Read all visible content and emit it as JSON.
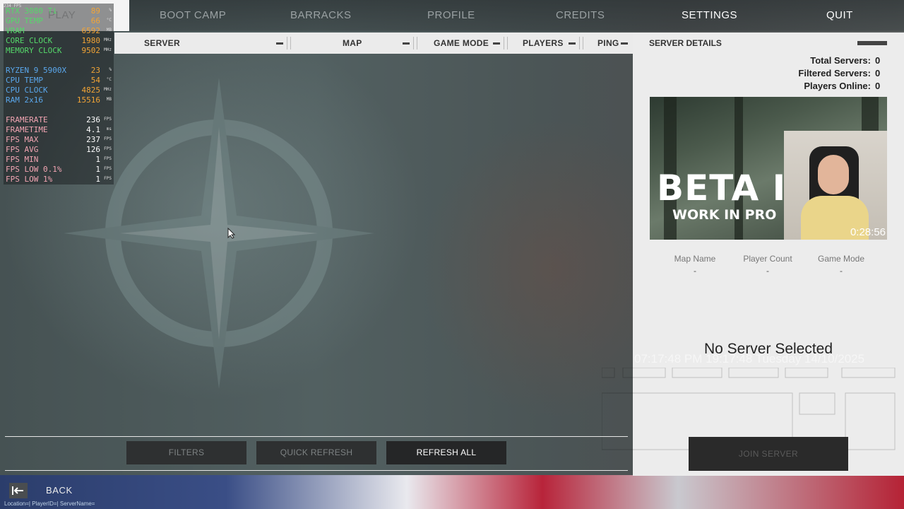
{
  "nav": {
    "play": "PLAY",
    "items": [
      "BOOT CAMP",
      "BARRACKS",
      "PROFILE",
      "CREDITS",
      "SETTINGS",
      "QUIT"
    ],
    "active": "SETTINGS"
  },
  "columns": {
    "server": "SERVER",
    "map": "MAP",
    "game_mode": "GAME MODE",
    "players": "PLAYERS",
    "ping": "PING"
  },
  "details": {
    "title": "SERVER DETAILS",
    "stats": [
      {
        "label": "Total Servers:",
        "value": "0"
      },
      {
        "label": "Filtered Servers:",
        "value": "0"
      },
      {
        "label": "Players Online:",
        "value": "0"
      }
    ],
    "preview": {
      "headline": "BETA I",
      "subtitle": "WORK IN PRO",
      "timer": "0:28:56"
    },
    "fields": [
      {
        "label": "Map Name",
        "value": "-"
      },
      {
        "label": "Player Count",
        "value": "-"
      },
      {
        "label": "Game Mode",
        "value": "-"
      }
    ],
    "no_server": "No Server Selected",
    "watermark": "07:17:48 PM 19:17:48 Tuesday 14/10/2025",
    "join_label": "JOIN SERVER"
  },
  "footer": {
    "filters": "FILTERS",
    "quick_refresh": "QUICK REFRESH",
    "refresh_all": "REFRESH ALL",
    "back": "BACK",
    "status": "Location=| PlayerID=| ServerName="
  },
  "osd": {
    "top_label": "234 FPS",
    "gpu": [
      {
        "k": "RTX 3080 Ti",
        "v": "89",
        "u": "%"
      },
      {
        "k": "GPU TEMP",
        "v": "66",
        "u": "°C"
      },
      {
        "k": "VRAM",
        "v": "6592",
        "u": "MB"
      },
      {
        "k": "CORE CLOCK",
        "v": "1980",
        "u": "MHz"
      },
      {
        "k": "MEMORY CLOCK",
        "v": "9502",
        "u": "MHz"
      }
    ],
    "cpu": [
      {
        "k": "RYZEN 9 5900X",
        "v": "23",
        "u": "%"
      },
      {
        "k": "CPU TEMP",
        "v": "54",
        "u": "°C"
      },
      {
        "k": "CPU CLOCK",
        "v": "4825",
        "u": "MHz"
      },
      {
        "k": "RAM 2x16",
        "v": "15516",
        "u": "MB"
      }
    ],
    "fps": [
      {
        "k": "FRAMERATE",
        "v": "236",
        "u": "FPS"
      },
      {
        "k": "FRAMETIME",
        "v": "4.1",
        "u": "ms"
      },
      {
        "k": "FPS MAX",
        "v": "237",
        "u": "FPS"
      },
      {
        "k": "FPS AVG",
        "v": "126",
        "u": "FPS"
      },
      {
        "k": "FPS MIN",
        "v": "1",
        "u": "FPS"
      },
      {
        "k": "FPS LOW 0.1%",
        "v": "1",
        "u": "FPS"
      },
      {
        "k": "FPS LOW 1%",
        "v": "1",
        "u": "FPS"
      }
    ]
  }
}
